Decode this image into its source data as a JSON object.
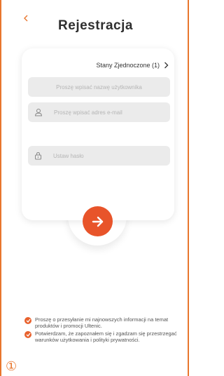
{
  "header": {
    "back_icon": "chevron-left-icon",
    "title": "Rejestracja"
  },
  "form": {
    "country": "Stany Zjednoczone (1)",
    "username_placeholder": "Proszę wpisać nazwę użytkownika",
    "email_placeholder": "Proszę wpisać adres e-mail",
    "password_placeholder": "Ustaw hasło",
    "submit_icon": "arrow-right-icon"
  },
  "consents": [
    {
      "text": "Proszę o przesyłanie mi najnowszych informacji na temat produktów i promocji Ultenic.",
      "checked": true
    },
    {
      "text": "Potwierdzam, że zapoznałem się i zgadzam się przestrzegać warunków użytkowania i polityki prywatności.",
      "checked": true
    }
  ],
  "footer": {
    "badge": "①"
  },
  "colors": {
    "accent": "#e8542a",
    "frame": "#e8762d",
    "field_bg": "#ebebeb"
  }
}
